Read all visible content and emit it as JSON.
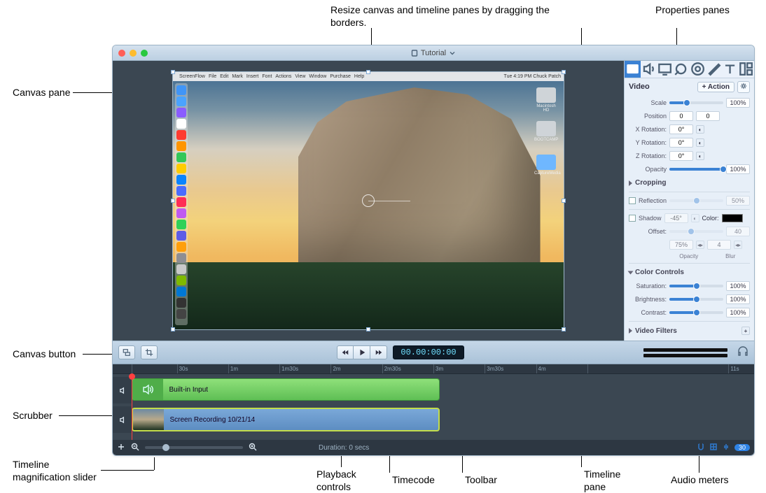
{
  "annotations": {
    "resize_hint": "Resize canvas and timeline panes by dragging the borders.",
    "properties_panes": "Properties panes",
    "canvas_pane": "Canvas pane",
    "canvas_button": "Canvas button",
    "scrubber": "Scrubber",
    "timeline_mag": "Timeline magnification slider",
    "playback_controls": "Playback controls",
    "timecode": "Timecode",
    "toolbar": "Toolbar",
    "timeline_pane": "Timeline pane",
    "audio_meters": "Audio meters"
  },
  "window": {
    "title": "Tutorial"
  },
  "inner_menubar": {
    "apple": "",
    "items": [
      "ScreenFlow",
      "File",
      "Edit",
      "Mark",
      "Insert",
      "Font",
      "Actions",
      "View",
      "Window",
      "Purchase",
      "Help"
    ],
    "right": "Tue 4:19 PM   Chuck Patch"
  },
  "desktop_icons": [
    {
      "label": "Macintosh HD",
      "color": "#cfd4d8"
    },
    {
      "label": "BOOTCAMP",
      "color": "#cfd4d8"
    },
    {
      "label": "CaptureMedia",
      "color": "#6fb7ff"
    }
  ],
  "dock_colors": [
    "#4095f7",
    "#4aa3ff",
    "#8a5cff",
    "#ffffff",
    "#ff3b30",
    "#ff9500",
    "#34c759",
    "#ffcc00",
    "#0a84ff",
    "#4a6cff",
    "#ff2d55",
    "#bf5af2",
    "#30d158",
    "#5e5ce6",
    "#ff9f0a",
    "#8e8e93",
    "#c9c9c9",
    "#7fba00",
    "#0078d4",
    "#333333",
    "#444444"
  ],
  "properties": {
    "tabs": [
      "video",
      "audio",
      "screen",
      "callout",
      "touch",
      "annotate",
      "text",
      "layout"
    ],
    "heading": "Video",
    "action_btn": "+ Action",
    "scale": {
      "label": "Scale",
      "value": "100%",
      "pct": 32
    },
    "position": {
      "label": "Position",
      "x": "0",
      "y": "0"
    },
    "xrot": {
      "label": "X Rotation:",
      "value": "0°"
    },
    "yrot": {
      "label": "Y Rotation:",
      "value": "0°"
    },
    "zrot": {
      "label": "Z Rotation:",
      "value": "0°"
    },
    "opacity": {
      "label": "Opacity",
      "value": "100%",
      "pct": 100
    },
    "cropping": "Cropping",
    "reflection": {
      "label": "Reflection",
      "value": "50%"
    },
    "shadow": {
      "label": "Shadow",
      "angle": "-45°",
      "color_label": "Color:"
    },
    "offset": {
      "label": "Offset:",
      "value": "40"
    },
    "shadow_opacity_label": "Opacity",
    "shadow_opacity": "75%",
    "shadow_blur_label": "Blur",
    "shadow_blur": "4",
    "color_controls": "Color Controls",
    "saturation": {
      "label": "Saturation:",
      "value": "100%",
      "pct": 50
    },
    "brightness": {
      "label": "Brightness:",
      "value": "100%",
      "pct": 50
    },
    "contrast": {
      "label": "Contrast:",
      "value": "100%",
      "pct": 50
    },
    "video_filters": "Video Filters"
  },
  "toolbar": {
    "timecode": "00.00:00:00"
  },
  "timeline": {
    "ruler": [
      "",
      "30s",
      "1m",
      "1m30s",
      "2m",
      "2m30s",
      "3m",
      "3m30s",
      "4m",
      "",
      "11s"
    ],
    "ruler_pos": [
      3,
      10,
      18,
      26,
      34,
      42,
      50,
      58,
      66,
      74,
      96
    ],
    "tracks": {
      "audio": {
        "label": "Built-in Input",
        "start": 3,
        "width": 48
      },
      "video": {
        "label": "Screen Recording 10/21/14",
        "start": 3,
        "width": 48
      }
    }
  },
  "bottombar": {
    "duration": "Duration: 0 secs",
    "zoom_pill": "30"
  }
}
